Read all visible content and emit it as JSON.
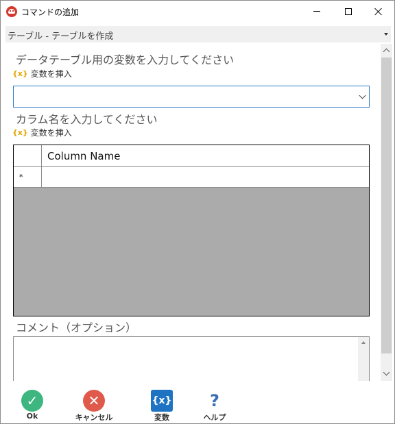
{
  "window": {
    "title": "コマンドの追加"
  },
  "command": {
    "header": "テーブル - テーブルを作成"
  },
  "form": {
    "datatable_label": "データテーブル用の変数を入力してください",
    "insert_variable_1": "変数を挿入",
    "datatable_value": "",
    "column_label": "カラム名を入力してください",
    "insert_variable_2": "変数を挿入",
    "grid": {
      "columns": [
        "Column Name"
      ],
      "new_row_marker": "*",
      "rows": [
        ""
      ]
    },
    "comment_label": "コメント（オプション）",
    "comment_value": ""
  },
  "footer": {
    "ok": "Ok",
    "cancel": "キャンセル",
    "variables": "変数",
    "variables_icon_text": "{x}",
    "help": "ヘルプ",
    "help_icon_text": "?"
  },
  "icons": {
    "insert_variable_glyph": "{x}",
    "ok_glyph": "✓",
    "cancel_glyph": "✕"
  },
  "colors": {
    "accent_border": "#2e7cc9",
    "ok": "#3db67f",
    "cancel": "#e05a4c",
    "variables": "#1e74c2",
    "insert_variable_icon": "#e2a500"
  }
}
